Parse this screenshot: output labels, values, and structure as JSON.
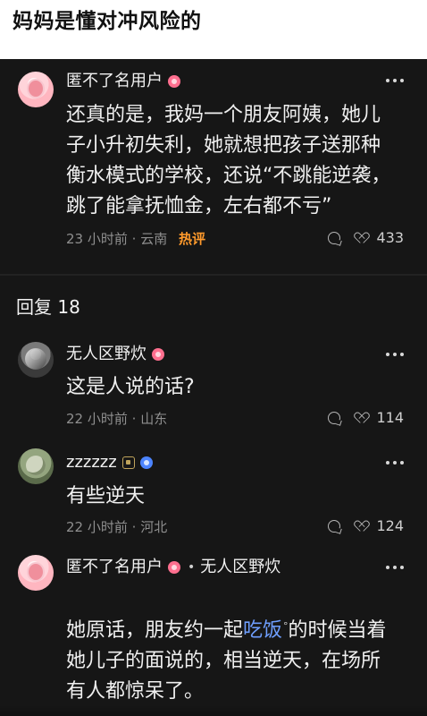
{
  "header": {
    "title": "妈妈是懂对冲风险的"
  },
  "thread": {
    "replies_label": "回复 18",
    "comments": [
      {
        "username": "匿不了名用户",
        "text": "还真的是，我妈一个朋友阿姨，她儿\n子小升初失利，她就想把孩子送那种\n衡水模式的学校，还说“不跳能逆袭，\n跳了能拿抚恤金，左右都不亏”",
        "time": "23 小时前",
        "dot": "·",
        "location": "云南",
        "tag": "热评",
        "likes": "433"
      },
      {
        "username": "无人区野炊",
        "text": "这是人说的话?",
        "time": "22 小时前",
        "dot": "·",
        "location": "山东",
        "likes": "114"
      },
      {
        "username": "zzzzzz",
        "text": "有些逆天",
        "time": "22 小时前",
        "dot": "·",
        "location": "河北",
        "likes": "124"
      },
      {
        "username": "匿不了名用户",
        "reply_to": "无人区野炊",
        "reply_arrow": "•",
        "text_part_1": "她原话，朋友约一起",
        "highlight": "吃饭",
        "degree": "°",
        "text_part_2": "的时候当着\n她儿子的面说的，相当逆天，在场所\n有人都惊呆了。"
      }
    ]
  },
  "icons": {
    "more": "more-icon",
    "comment": "comment-icon",
    "like": "heart-icon",
    "badge_pink": "pink-badge-icon",
    "badge_level": "level-badge-icon",
    "badge_blue": "blue-badge-icon"
  },
  "colors": {
    "background": "#161616",
    "header_background": "#ffffff",
    "hot_tag": "#ff9a2c",
    "highlight": "#6f9fff"
  }
}
